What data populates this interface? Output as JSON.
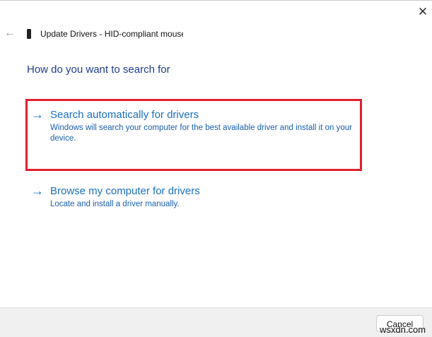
{
  "window": {
    "title": "Update Drivers - HID-compliant mouse"
  },
  "heading": "How do you want to search for",
  "options": [
    {
      "title": "Search automatically for drivers",
      "description": "Windows will search your computer for the best available driver and install it on your device."
    },
    {
      "title": "Browse my computer for drivers",
      "description": "Locate and install a driver manually."
    }
  ],
  "footer": {
    "cancel_label": "Cancel"
  },
  "watermark": "wsxdn.com",
  "colors": {
    "highlight": "#e0202e",
    "link": "#1a6fc0",
    "heading": "#1e3c8c"
  }
}
